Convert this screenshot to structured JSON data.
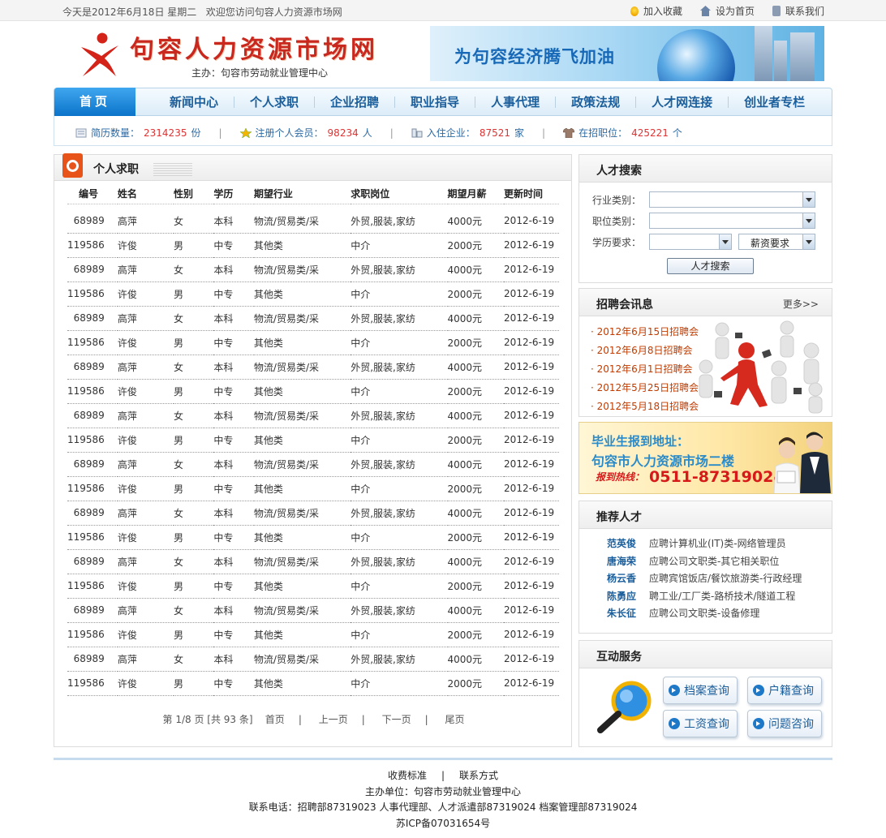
{
  "topbar": {
    "date_text": "今天是2012年6月18日 星期二",
    "welcome": "欢迎您访问句容人力资源市场网",
    "links": {
      "favorite": "加入收藏",
      "homepage": "设为首页",
      "contact": "联系我们"
    }
  },
  "header": {
    "site_name": "句容人力资源市场网",
    "sponsor": "主办：句容市劳动就业管理中心",
    "banner_slogan": "为句容经济腾飞加油"
  },
  "nav": {
    "home": "首页",
    "items": [
      "新闻中心",
      "个人求职",
      "企业招聘",
      "职业指导",
      "人事代理",
      "政策法规",
      "人才网连接",
      "创业者专栏"
    ]
  },
  "stats": [
    {
      "label": "简历数量：",
      "value": "2314235",
      "unit": "份"
    },
    {
      "label": "注册个人会员：",
      "value": "98234",
      "unit": "人"
    },
    {
      "label": "入住企业：",
      "value": "87521",
      "unit": "家"
    },
    {
      "label": "在招职位：",
      "value": "425221",
      "unit": "个"
    }
  ],
  "jobs": {
    "title": "个人求职",
    "headers": [
      "编号",
      "姓名",
      "性别",
      "学历",
      "期望行业",
      "求职岗位",
      "期望月薪",
      "更新时间"
    ],
    "rows": [
      [
        "68989",
        "高萍",
        "女",
        "本科",
        "物流/贸易类/采",
        "外贸,服装,家纺",
        "4000元",
        "2012-6-19"
      ],
      [
        "119586",
        "许俊",
        "男",
        "中专",
        "其他类",
        "中介",
        "2000元",
        "2012-6-19"
      ],
      [
        "68989",
        "高萍",
        "女",
        "本科",
        "物流/贸易类/采",
        "外贸,服装,家纺",
        "4000元",
        "2012-6-19"
      ],
      [
        "119586",
        "许俊",
        "男",
        "中专",
        "其他类",
        "中介",
        "2000元",
        "2012-6-19"
      ],
      [
        "68989",
        "高萍",
        "女",
        "本科",
        "物流/贸易类/采",
        "外贸,服装,家纺",
        "4000元",
        "2012-6-19"
      ],
      [
        "119586",
        "许俊",
        "男",
        "中专",
        "其他类",
        "中介",
        "2000元",
        "2012-6-19"
      ],
      [
        "68989",
        "高萍",
        "女",
        "本科",
        "物流/贸易类/采",
        "外贸,服装,家纺",
        "4000元",
        "2012-6-19"
      ],
      [
        "119586",
        "许俊",
        "男",
        "中专",
        "其他类",
        "中介",
        "2000元",
        "2012-6-19"
      ],
      [
        "68989",
        "高萍",
        "女",
        "本科",
        "物流/贸易类/采",
        "外贸,服装,家纺",
        "4000元",
        "2012-6-19"
      ],
      [
        "119586",
        "许俊",
        "男",
        "中专",
        "其他类",
        "中介",
        "2000元",
        "2012-6-19"
      ],
      [
        "68989",
        "高萍",
        "女",
        "本科",
        "物流/贸易类/采",
        "外贸,服装,家纺",
        "4000元",
        "2012-6-19"
      ],
      [
        "119586",
        "许俊",
        "男",
        "中专",
        "其他类",
        "中介",
        "2000元",
        "2012-6-19"
      ],
      [
        "68989",
        "高萍",
        "女",
        "本科",
        "物流/贸易类/采",
        "外贸,服装,家纺",
        "4000元",
        "2012-6-19"
      ],
      [
        "119586",
        "许俊",
        "男",
        "中专",
        "其他类",
        "中介",
        "2000元",
        "2012-6-19"
      ],
      [
        "68989",
        "高萍",
        "女",
        "本科",
        "物流/贸易类/采",
        "外贸,服装,家纺",
        "4000元",
        "2012-6-19"
      ],
      [
        "119586",
        "许俊",
        "男",
        "中专",
        "其他类",
        "中介",
        "2000元",
        "2012-6-19"
      ],
      [
        "68989",
        "高萍",
        "女",
        "本科",
        "物流/贸易类/采",
        "外贸,服装,家纺",
        "4000元",
        "2012-6-19"
      ],
      [
        "119586",
        "许俊",
        "男",
        "中专",
        "其他类",
        "中介",
        "2000元",
        "2012-6-19"
      ],
      [
        "68989",
        "高萍",
        "女",
        "本科",
        "物流/贸易类/采",
        "外贸,服装,家纺",
        "4000元",
        "2012-6-19"
      ],
      [
        "119586",
        "许俊",
        "男",
        "中专",
        "其他类",
        "中介",
        "2000元",
        "2012-6-19"
      ]
    ],
    "pager": {
      "info": "第 1/8 页 [共 93 条]",
      "first": "首页",
      "prev": "上一页",
      "next": "下一页",
      "last": "尾页"
    }
  },
  "search": {
    "title": "人才搜索",
    "industry_label": "行业类别：",
    "position_label": "职位类别：",
    "education_label": "学历要求：",
    "salary_select": "薪资要求",
    "button": "人才搜索"
  },
  "fairs": {
    "title": "招聘会讯息",
    "more": "更多>>",
    "items": [
      "2012年6月15日招聘会",
      "2012年6月8日招聘会",
      "2012年6月1日招聘会",
      "2012年5月25日招聘会",
      "2012年5月18日招聘会"
    ]
  },
  "promo": {
    "line1": "毕业生报到地址：",
    "line2": "句容市人力资源市场二楼",
    "hotline_label": "报到热线：",
    "phone": "0511-87319024"
  },
  "talents": {
    "title": "推荐人才",
    "items": [
      {
        "name": "范英俊",
        "desc": "应聘计算机业(IT)类-网络管理员"
      },
      {
        "name": "唐海荣",
        "desc": "应聘公司文职类-其它相关职位"
      },
      {
        "name": "杨云香",
        "desc": "应聘宾馆饭店/餐饮旅游类-行政经理"
      },
      {
        "name": "陈勇应",
        "desc": "聘工业/工厂类-路桥技术/隧道工程"
      },
      {
        "name": "朱长征",
        "desc": "应聘公司文职类-设备修理"
      }
    ]
  },
  "services": {
    "title": "互动服务",
    "buttons": [
      "档案查询",
      "户籍查询",
      "工资查询",
      "问题咨询"
    ]
  },
  "footer": {
    "fees": "收费标准",
    "contact": "联系方式",
    "sponsor": "主办单位：句容市劳动就业管理中心",
    "phones": "联系电话：招聘部87319023  人事代理部、人才派遣部87319024  档案管理部87319024",
    "icp": "苏ICP备07031654号"
  }
}
